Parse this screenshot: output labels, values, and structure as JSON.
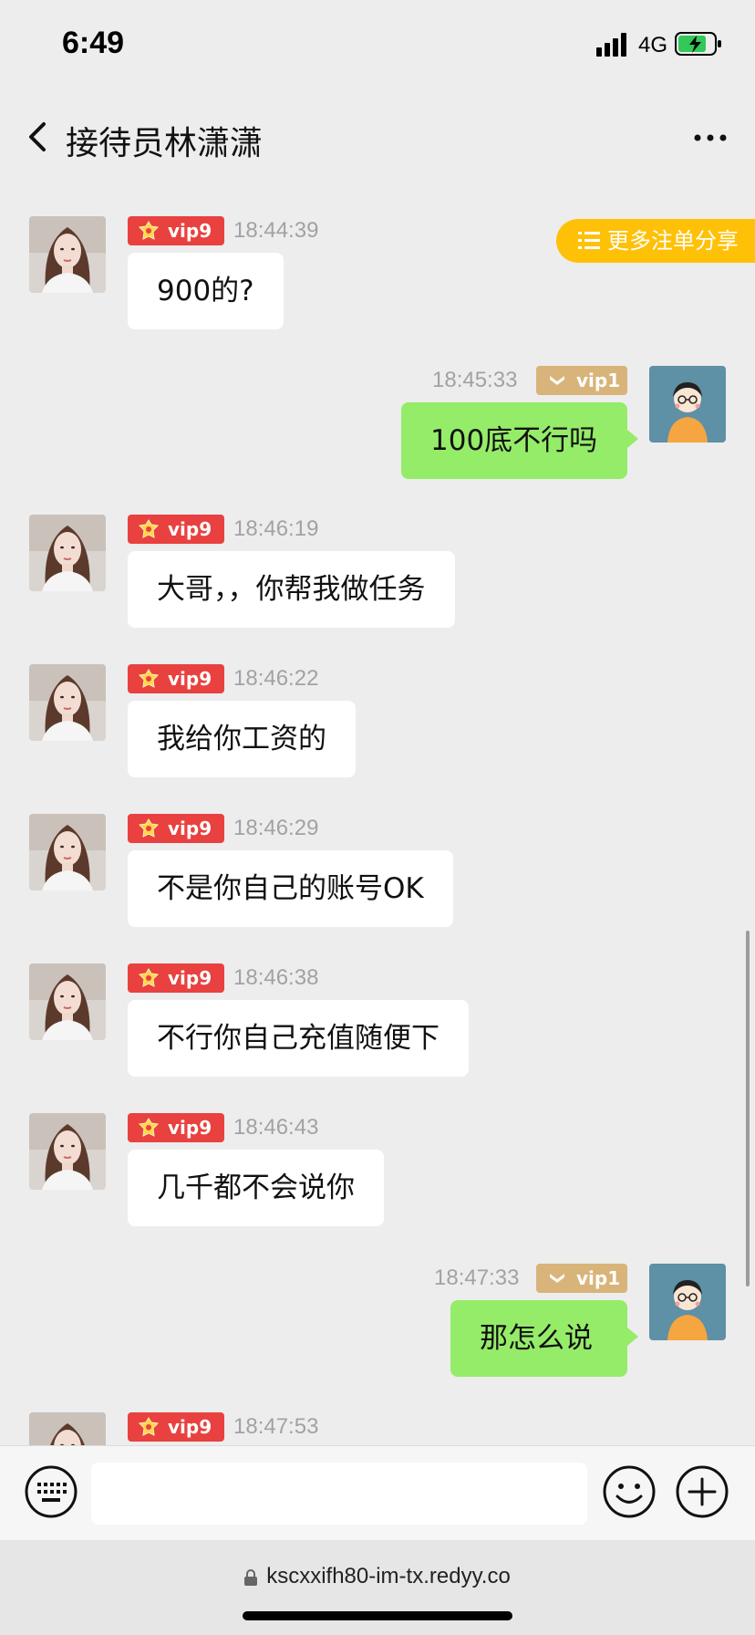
{
  "status": {
    "time": "6:49",
    "network": "4G"
  },
  "nav": {
    "title": "接待员林潇潇"
  },
  "share_button": {
    "label": "更多注单分享"
  },
  "messages": [
    {
      "side": "left",
      "badge": "vip9",
      "time": "18:44:39",
      "text": "900的?"
    },
    {
      "side": "right",
      "badge": "vip1",
      "time": "18:45:33",
      "text": "100底不行吗"
    },
    {
      "side": "left",
      "badge": "vip9",
      "time": "18:46:19",
      "text": "大哥，，你帮我做任务"
    },
    {
      "side": "left",
      "badge": "vip9",
      "time": "18:46:22",
      "text": "我给你工资的"
    },
    {
      "side": "left",
      "badge": "vip9",
      "time": "18:46:29",
      "text": "不是你自己的账号OK"
    },
    {
      "side": "left",
      "badge": "vip9",
      "time": "18:46:38",
      "text": "不行你自己充值随便下"
    },
    {
      "side": "left",
      "badge": "vip9",
      "time": "18:46:43",
      "text": "几千都不会说你"
    },
    {
      "side": "right",
      "badge": "vip1",
      "time": "18:47:33",
      "text": "那怎么说"
    },
    {
      "side": "left",
      "badge": "vip9",
      "time": "18:47:53",
      "text": ""
    }
  ],
  "browser": {
    "url": "kscxxifh80-im-tx.redyy.co"
  },
  "colors": {
    "vip9": "#e8413f",
    "vip1": "#d8b47a",
    "bubble_self": "#95ec69",
    "share": "#ffc107"
  }
}
